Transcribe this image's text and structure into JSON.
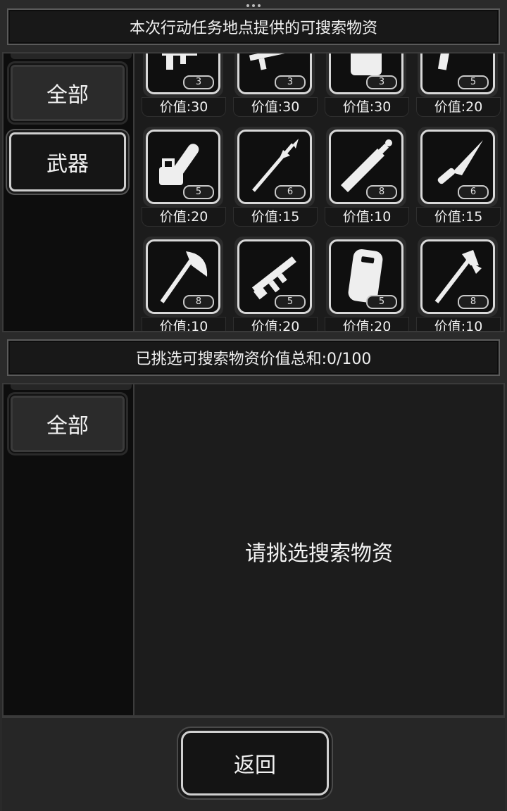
{
  "top_banner": {
    "title": "本次行动任务地点提供的可搜索物资"
  },
  "upper_panel": {
    "categories": [
      {
        "label": "全部",
        "selected": true
      },
      {
        "label": "武器",
        "selected": false
      }
    ],
    "items": [
      {
        "icon": "smg-icon",
        "count": "3",
        "value": "价值:30"
      },
      {
        "icon": "sniper-rifle-icon",
        "count": "3",
        "value": "价值:30"
      },
      {
        "icon": "backpack-icon",
        "count": "3",
        "value": "价值:30"
      },
      {
        "icon": "pistol-icon",
        "count": "5",
        "value": "价值:20"
      },
      {
        "icon": "chainsaw-icon",
        "count": "5",
        "value": "价值:20"
      },
      {
        "icon": "spear-icon",
        "count": "6",
        "value": "价值:15"
      },
      {
        "icon": "sword-icon",
        "count": "8",
        "value": "价值:10"
      },
      {
        "icon": "knife-icon",
        "count": "6",
        "value": "价值:15"
      },
      {
        "icon": "axe-icon",
        "count": "8",
        "value": "价值:10"
      },
      {
        "icon": "assault-rifle-icon",
        "count": "5",
        "value": "价值:20"
      },
      {
        "icon": "riot-shield-icon",
        "count": "5",
        "value": "价值:20"
      },
      {
        "icon": "fire-axe-icon",
        "count": "8",
        "value": "价值:10"
      }
    ]
  },
  "mid_banner": {
    "title": "已挑选可搜索物资价值总和:0/100"
  },
  "lower_panel": {
    "categories": [
      {
        "label": "全部",
        "selected": true
      }
    ],
    "empty_hint": "请挑选搜索物资"
  },
  "footer": {
    "back_label": "返回"
  },
  "colors": {
    "background": "#2a2a2a",
    "panel": "#1c1c1c",
    "sidebar": "#0d0d0d",
    "border_light": "#d8d8d8"
  }
}
